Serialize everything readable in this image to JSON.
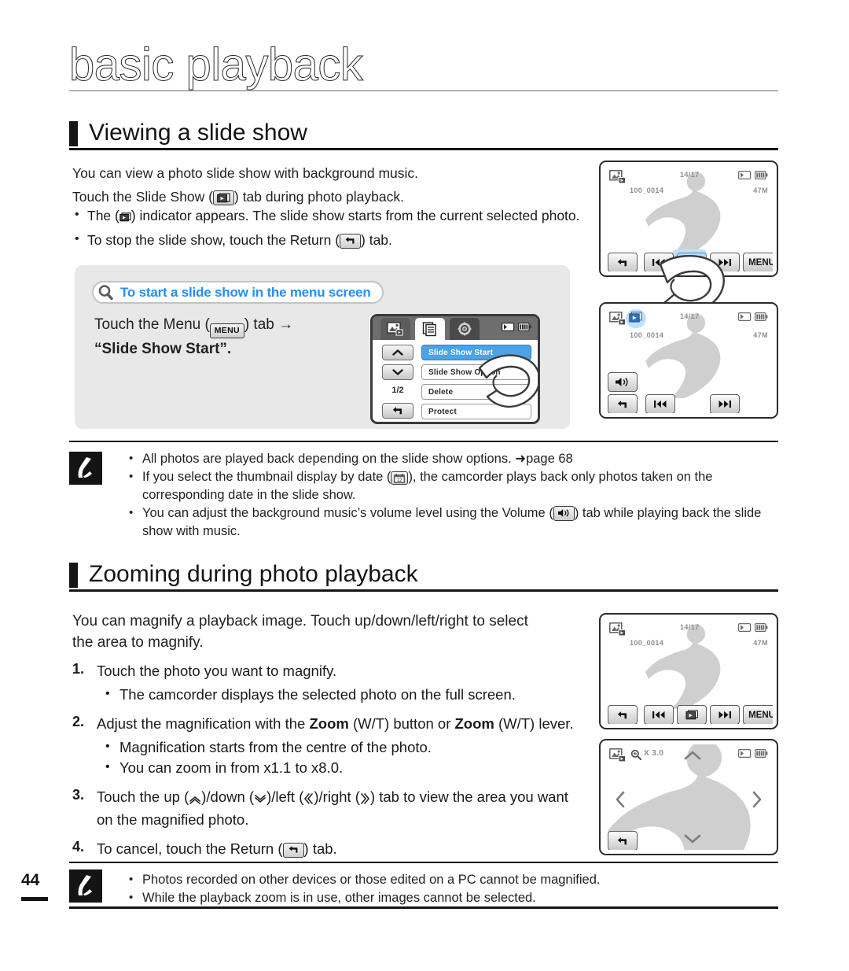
{
  "chapter": {
    "title": "basic playback"
  },
  "page": {
    "number": "44"
  },
  "sections": {
    "slideshow": {
      "heading": "Viewing a slide show",
      "intro": "You can view a photo slide show with background music.",
      "lead": "Touch the Slide Show (",
      "lead_tail": ") tab during photo playback.",
      "bullets": [
        {
          "pre": "The (",
          "post": ") indicator appears. The slide show starts from the current selected photo."
        },
        {
          "pre": "To stop the slide show, touch the Return (",
          "post": ") tab."
        }
      ]
    },
    "zoom": {
      "heading": "Zooming during photo playback",
      "intro": "You can magnify a playback image. Touch up/down/left/right to select the area to magnify.",
      "steps": [
        {
          "num": "1.",
          "text": "Touch the photo you want to magnify.",
          "bullets": [
            "The camcorder displays the selected photo on the full screen."
          ]
        },
        {
          "num": "2.",
          "text_a": "Adjust the magnification with the ",
          "bold_a": "Zoom",
          "text_b": " (W/T) button or ",
          "bold_b": "Zoom",
          "text_c": " (W/T) lever.",
          "bullets": [
            "Magnification starts from the centre of the photo.",
            "You can zoom in from x1.1 to x8.0."
          ]
        },
        {
          "num": "3.",
          "text_pre": "Touch the up (",
          "text_mid1": ")/down (",
          "text_mid2": ")/left (",
          "text_mid3": ")/right (",
          "text_post": ") tab to view the area you want on the magnified photo."
        },
        {
          "num": "4.",
          "text_pre": "To cancel, touch the Return (",
          "text_post": ") tab."
        }
      ]
    }
  },
  "tipbox": {
    "title": "To start a slide show in the menu screen",
    "body_pre": "Touch the Menu (",
    "body_mid": ") tab ",
    "body_arrow": "→",
    "body_quote": "“Slide Show Start”.",
    "menu_label": "MENU"
  },
  "menu_screen": {
    "rows": [
      "Slide Show Start",
      "Slide Show Option",
      "Delete",
      "Protect"
    ],
    "selected_index": 0,
    "page_indicator": "1/2",
    "tabs": [
      "photo-mode-tab",
      "list-tab",
      "settings-tab"
    ]
  },
  "notes": {
    "slideshow": [
      {
        "text": "All photos are played back depending on the slide show options. ",
        "ref_arrow": "➜",
        "ref": "page 68"
      },
      {
        "pre": "If you select the thumbnail display by date (",
        "post": "), the camcorder plays back only photos taken on the corresponding date in the slide show."
      },
      {
        "pre": "You can adjust the background music’s volume level using the Volume (",
        "post": ") tab while playing back the slide show with music."
      }
    ],
    "zoom": [
      "Photos recorded on other devices or those edited on a PC cannot be magnified.",
      "While the playback zoom is in use, other images cannot be selected."
    ]
  },
  "lcd_screens": {
    "slideshow_playback": {
      "file_name": "100_0014",
      "counter": "14/17",
      "size": "47M",
      "buttons": [
        "return",
        "prev",
        "slideshow",
        "next",
        "MENU"
      ],
      "menu_label": "MENU",
      "highlighted": "slideshow"
    },
    "slideshow_running": {
      "file_name": "100_0014",
      "counter": "14/17",
      "size": "47M",
      "buttons": [
        "volume",
        "return",
        "prev",
        "next"
      ]
    },
    "photo_playback": {
      "file_name": "100_0014",
      "counter": "14/17",
      "size": "47M",
      "buttons": [
        "return",
        "prev",
        "slideshow",
        "next",
        "MENU"
      ],
      "menu_label": "MENU"
    },
    "zoom_view": {
      "magnification": "X 3.0",
      "buttons": [
        "return",
        "up",
        "down",
        "left",
        "right"
      ]
    }
  },
  "colors": {
    "accent_blue": "#1e90ff",
    "menu_select": "#4aa3e8",
    "ink": "#141414",
    "tipbox_bg": "#e8e8e8"
  }
}
